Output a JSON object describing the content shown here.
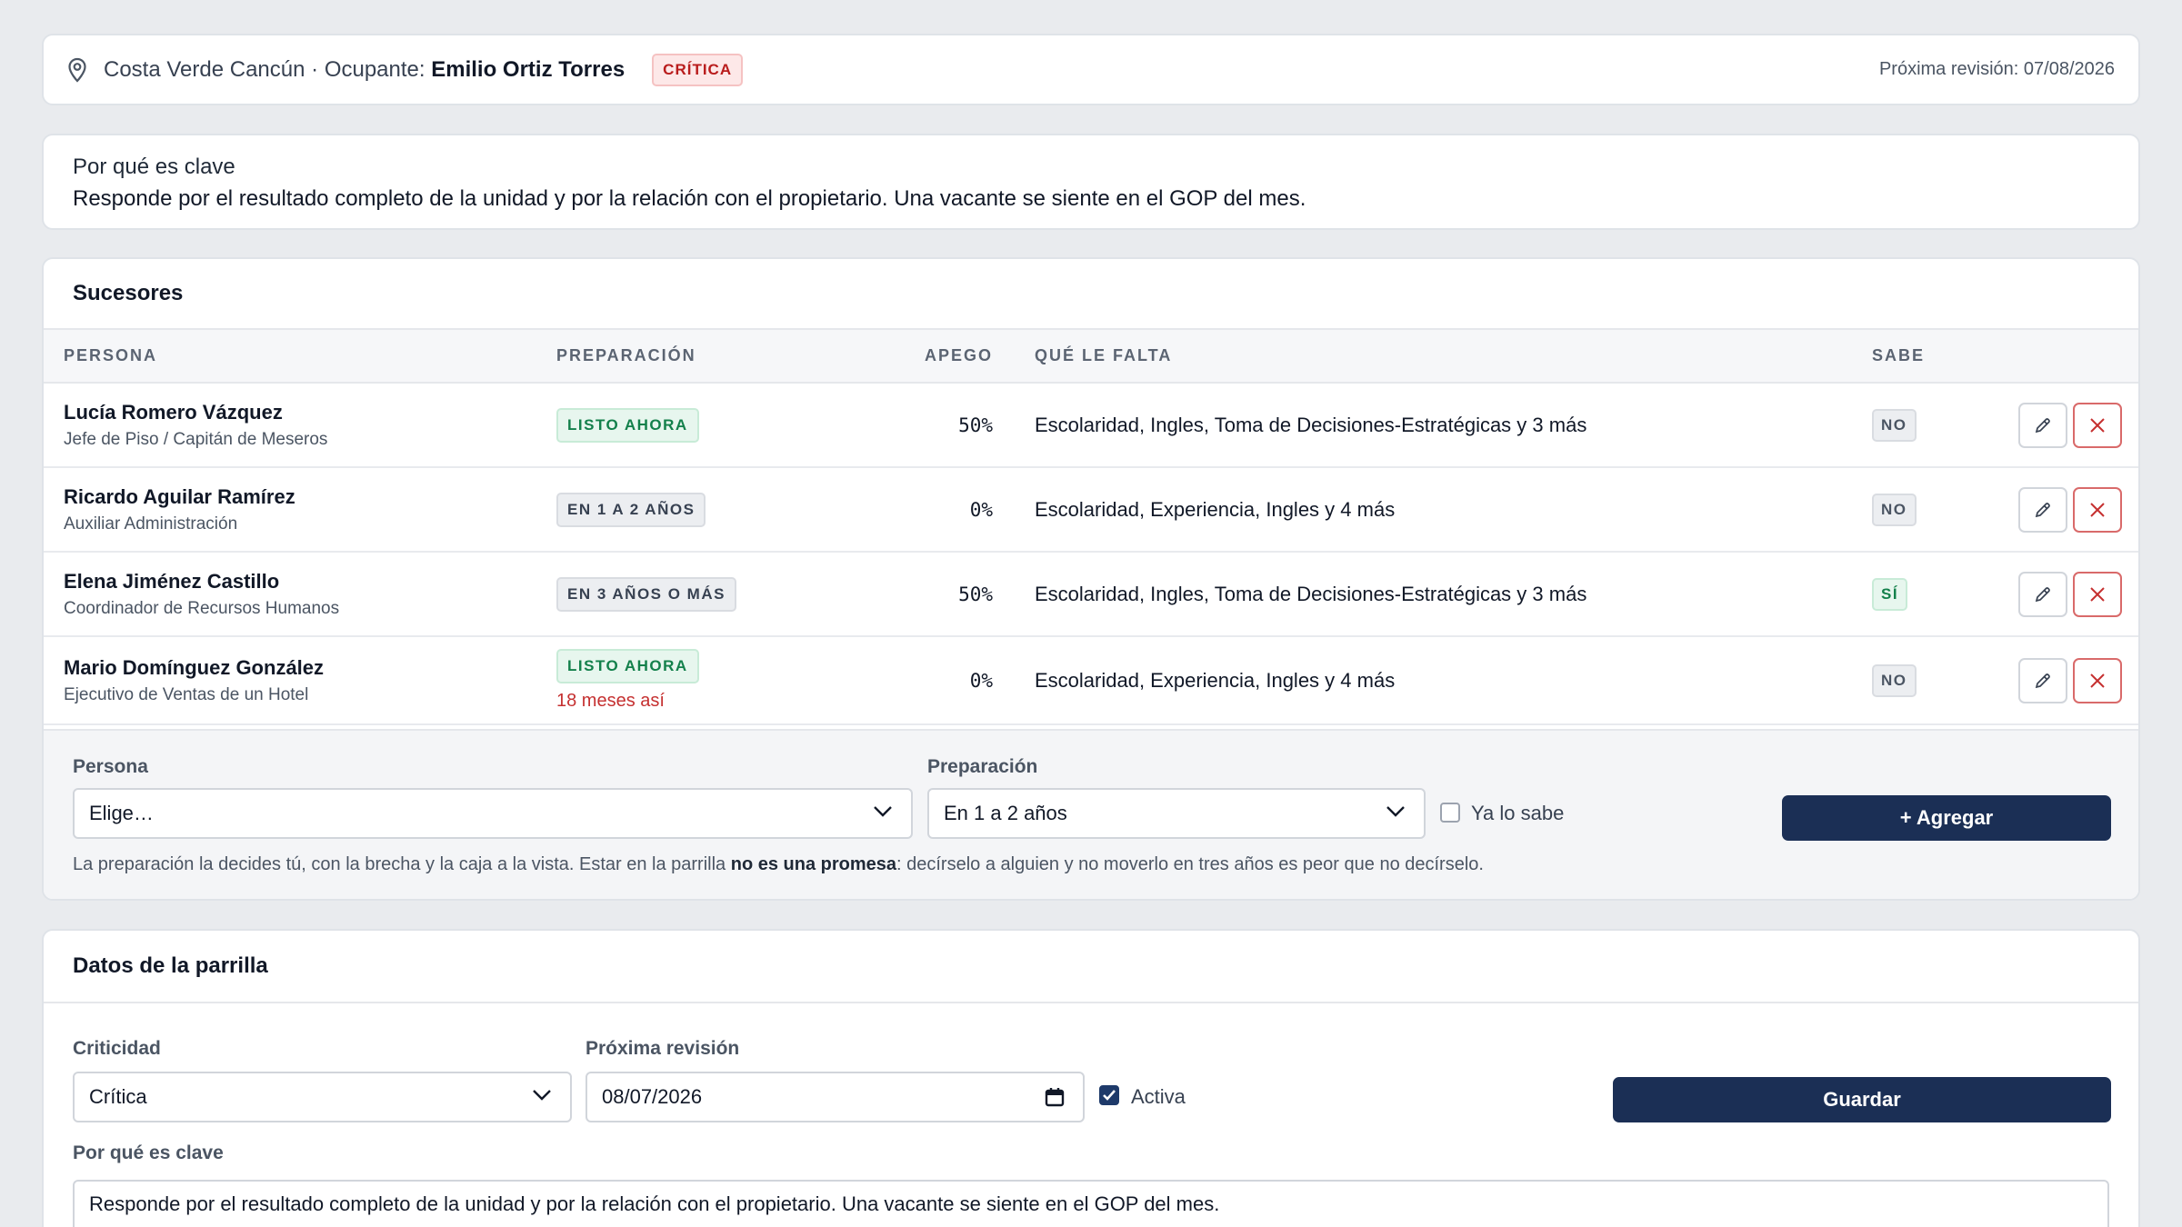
{
  "header": {
    "location": "Costa Verde Cancún",
    "separator": " · Ocupante: ",
    "occupant": "Emilio Ortiz Torres",
    "criticality_badge": "CRÍTICA",
    "next_review": "Próxima revisión: 07/08/2026"
  },
  "why": {
    "title": "Por qué es clave",
    "text": "Responde por el resultado completo de la unidad y por la relación con el propietario. Una vacante se siente en el GOP del mes."
  },
  "successors": {
    "title": "Sucesores",
    "columns": [
      "PERSONA",
      "PREPARACIÓN",
      "APEGO",
      "QUÉ LE FALTA",
      "SABE"
    ],
    "rows": [
      {
        "name": "Lucía Romero Vázquez",
        "role": "Jefe de Piso / Capitán de Meseros",
        "prep": "LISTO AHORA",
        "prep_tone": "green",
        "warning": "",
        "apego": "50%",
        "falta": "Escolaridad, Ingles, Toma de Decisiones-Estratégicas y 3 más",
        "sabe": "NO"
      },
      {
        "name": "Ricardo Aguilar Ramírez",
        "role": "Auxiliar Administración",
        "prep": "EN 1 A 2 AÑOS",
        "prep_tone": "gray",
        "warning": "",
        "apego": "0%",
        "falta": "Escolaridad, Experiencia, Ingles y 4 más",
        "sabe": "NO"
      },
      {
        "name": "Elena Jiménez Castillo",
        "role": "Coordinador de Recursos Humanos",
        "prep": "EN 3 AÑOS O MÁS",
        "prep_tone": "gray",
        "warning": "",
        "apego": "50%",
        "falta": "Escolaridad, Ingles, Toma de Decisiones-Estratégicas y 3 más",
        "sabe": "SÍ"
      },
      {
        "name": "Mario Domínguez González",
        "role": "Ejecutivo de Ventas de un Hotel",
        "prep": "LISTO AHORA",
        "prep_tone": "green",
        "warning": "18 meses así",
        "apego": "0%",
        "falta": "Escolaridad, Experiencia, Ingles y 4 más",
        "sabe": "NO"
      }
    ],
    "add_form": {
      "persona_label": "Persona",
      "persona_value": "Elige…",
      "prep_label": "Preparación",
      "prep_value": "En 1 a 2 años",
      "knows_label": "Ya lo sabe",
      "knows_checked": false,
      "add_button": "+ Agregar",
      "note_before": "La preparación la decides tú, con la brecha y la caja a la vista. Estar en la parrilla ",
      "note_bold": "no es una promesa",
      "note_after": ": decírselo a alguien y no moverlo en tres años es peor que no decírselo."
    }
  },
  "grid_data": {
    "title": "Datos de la parrilla",
    "criticality_label": "Criticidad",
    "criticality_value": "Crítica",
    "next_review_label": "Próxima revisión",
    "next_review_value": "08/07/2026",
    "active_label": "Activa",
    "active_checked": true,
    "save_button": "Guardar",
    "why_label": "Por qué es clave",
    "why_value": "Responde por el resultado completo de la unidad y por la relación con el propietario. Una vacante se siente en el GOP del mes."
  },
  "colors": {
    "primary": "#1b2f55",
    "critical": "#b91c1c",
    "ready": "#13804b",
    "warning": "#c53030"
  }
}
